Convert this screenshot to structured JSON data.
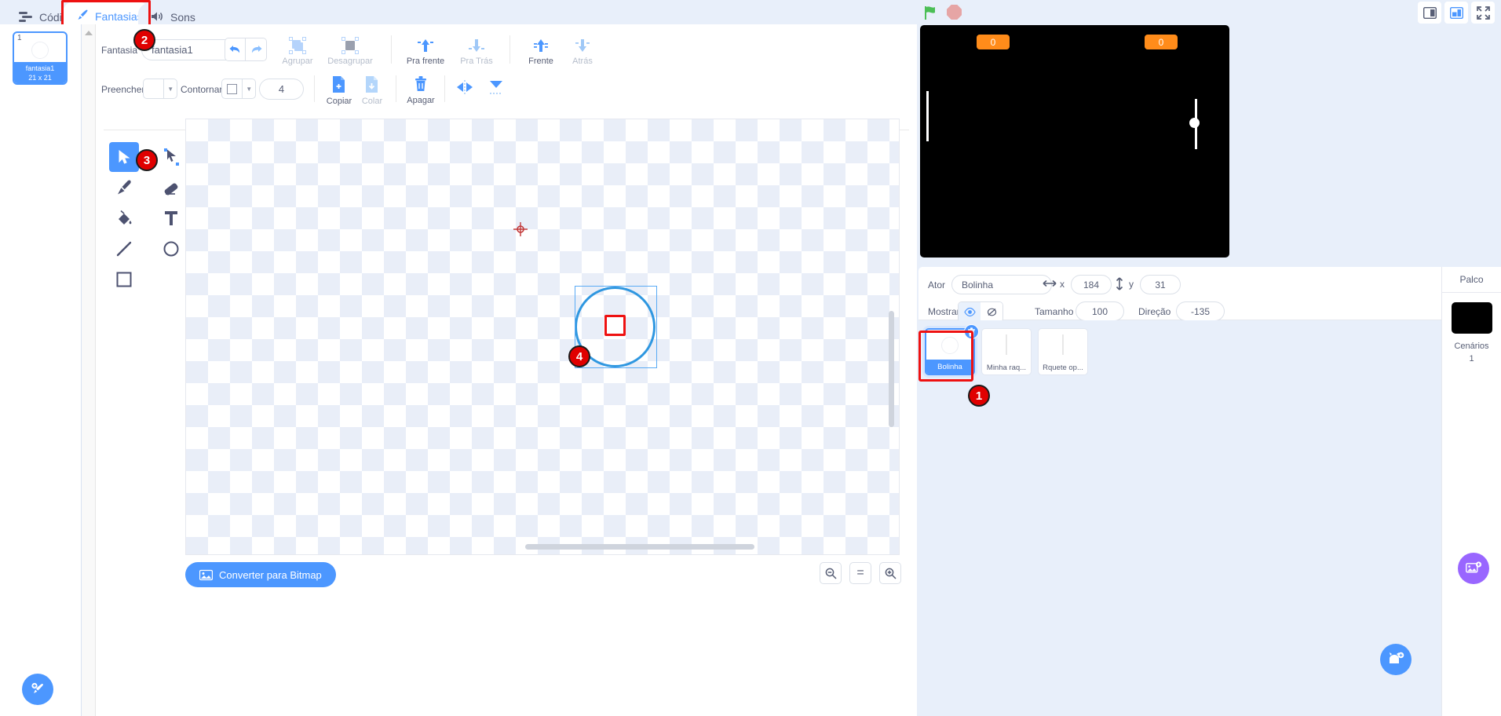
{
  "tabs": [
    {
      "label": "Código",
      "icon": "code-icon",
      "active": false
    },
    {
      "label": "Fantasias",
      "icon": "paintbrush-icon",
      "active": true
    },
    {
      "label": "Sons",
      "icon": "speaker-icon",
      "active": false
    }
  ],
  "costume_list": {
    "items": [
      {
        "index": "1",
        "name": "fantasia1",
        "size": "21 x 21"
      }
    ],
    "add_button": "add-costume-button"
  },
  "paint": {
    "costume_label": "Fantasia",
    "costume_name": "fantasia1",
    "undo_label": "undo-icon",
    "redo_label": "redo-icon",
    "group_label": "Agrupar",
    "ungroup_label": "Desagrupar",
    "forward_label": "Pra frente",
    "backward_label": "Pra Trás",
    "front_label": "Frente",
    "back_label": "Atrás",
    "fill_label": "Preencher",
    "outline_label": "Contornar",
    "stroke_width": "4",
    "copy_label": "Copiar",
    "paste_label": "Colar",
    "delete_label": "Apagar",
    "flip_h_label": "flip-horizontal-icon",
    "flip_v_label": "flip-vertical-icon",
    "convert_button": "Converter para Bitmap",
    "zoom_out": "−",
    "zoom_reset": "=",
    "zoom_in": "+"
  },
  "tools": [
    {
      "name": "select-tool",
      "selected": true
    },
    {
      "name": "reshape-tool",
      "selected": false
    },
    {
      "name": "brush-tool",
      "selected": false
    },
    {
      "name": "eraser-tool",
      "selected": false
    },
    {
      "name": "fill-tool",
      "selected": false
    },
    {
      "name": "text-tool",
      "selected": false
    },
    {
      "name": "line-tool",
      "selected": false
    },
    {
      "name": "circle-tool",
      "selected": false
    },
    {
      "name": "rectangle-tool",
      "selected": false
    }
  ],
  "stage": {
    "green_flag": "green-flag-icon",
    "stop": "stop-icon",
    "small_stage": "small-stage-icon",
    "large_stage": "large-stage-icon",
    "fullscreen": "fullscreen-icon",
    "monitors": [
      {
        "value": "0"
      },
      {
        "value": "0"
      }
    ]
  },
  "sprite_info": {
    "sprite_label": "Ator",
    "sprite_name": "Bolinha",
    "x_label": "x",
    "x_value": "184",
    "y_label": "y",
    "y_value": "31",
    "show_label": "Mostrar",
    "show_on_icon": "eye-icon",
    "show_off_icon": "eye-slash-icon",
    "size_label": "Tamanho",
    "size_value": "100",
    "direction_label": "Direção",
    "direction_value": "-135"
  },
  "sprites": [
    {
      "name": "Bolinha",
      "selected": true,
      "thumb": "circle"
    },
    {
      "name": "Minha raq...",
      "selected": false,
      "thumb": "bar"
    },
    {
      "name": "Rquete op...",
      "selected": false,
      "thumb": "bar"
    }
  ],
  "palco": {
    "title": "Palco",
    "backdrops_label": "Cenários",
    "backdrops_count": "1"
  },
  "annotations": [
    {
      "id": "1",
      "target": "sprite-bolinha"
    },
    {
      "id": "2",
      "target": "costume-name-input"
    },
    {
      "id": "3",
      "target": "select-tool"
    },
    {
      "id": "4",
      "target": "canvas-selection"
    }
  ],
  "colors": {
    "accent": "#4c97ff",
    "highlight": "#ee1111",
    "monitor": "#ff8c1a",
    "backdrop_accent": "#9966ff",
    "panel_bg": "#e8effa"
  }
}
